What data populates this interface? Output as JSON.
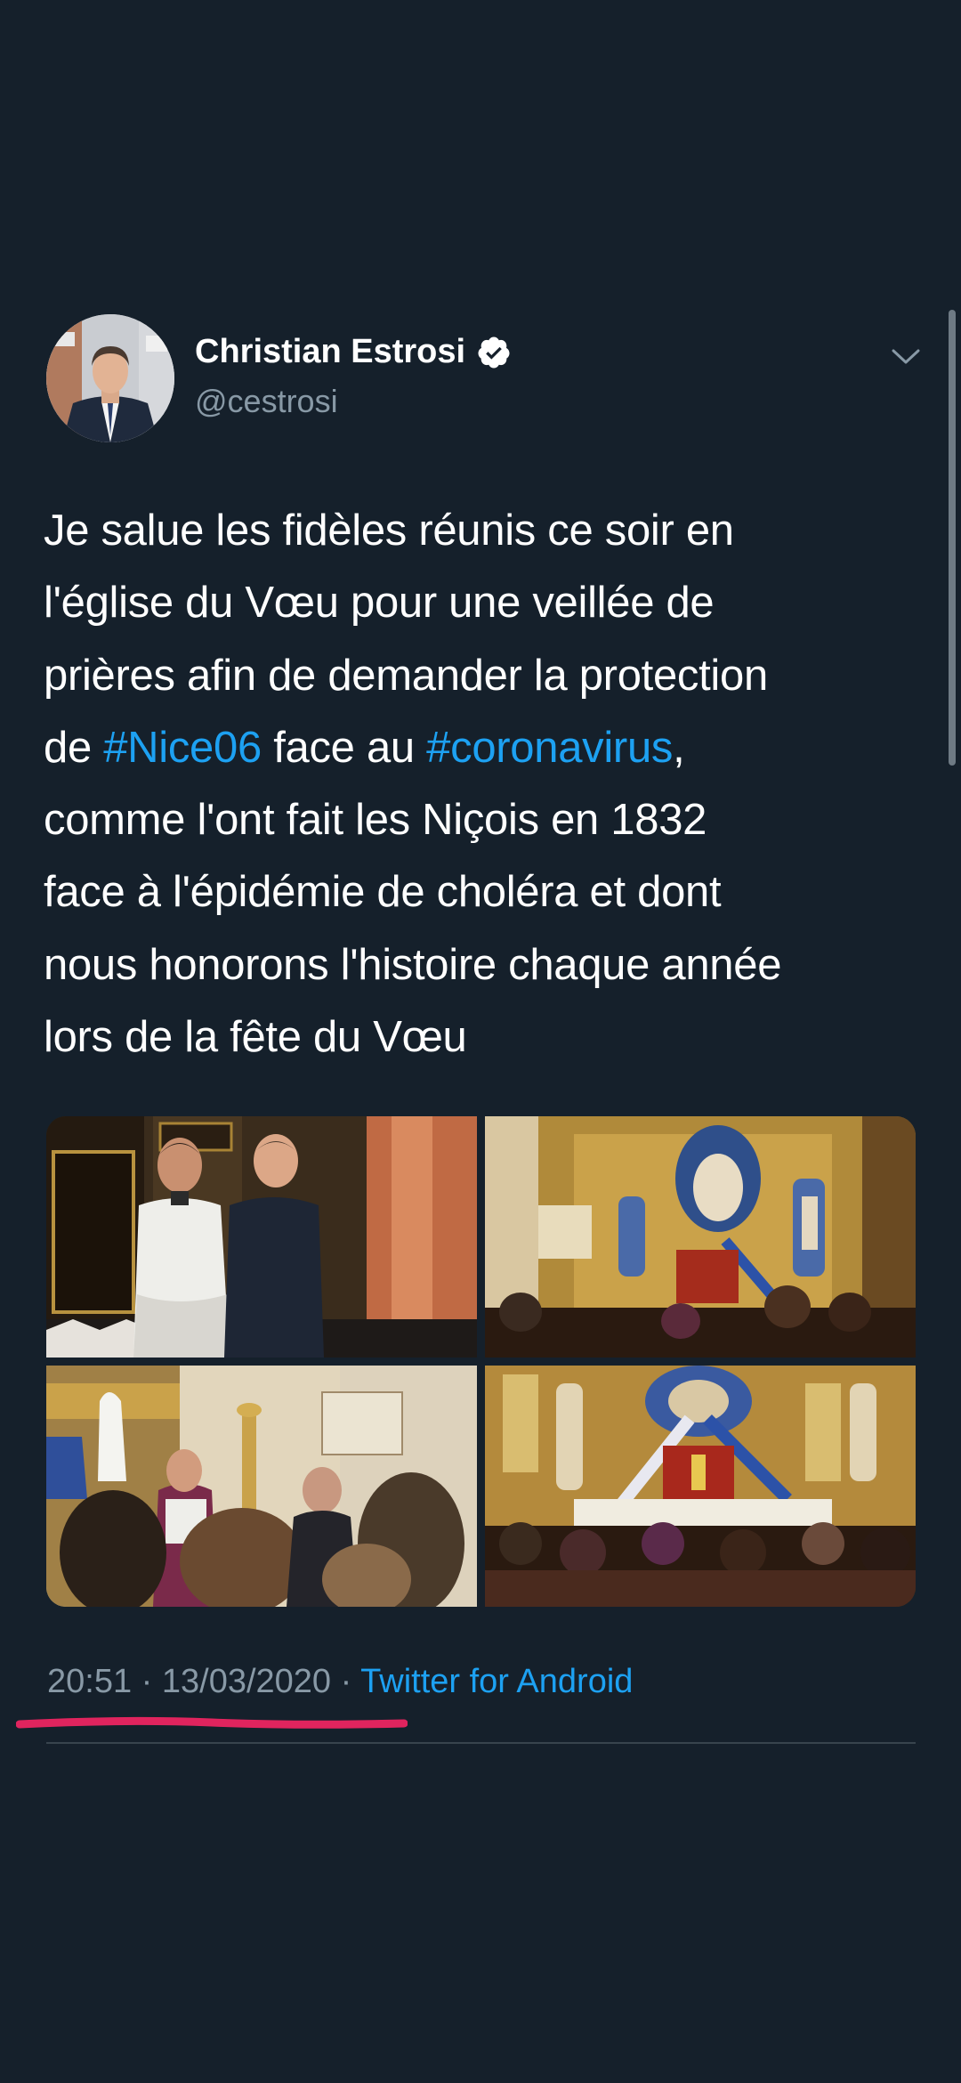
{
  "author": {
    "name": "Christian Estrosi",
    "handle": "@cestrosi",
    "verified": true
  },
  "tweet": {
    "lines": [
      [
        {
          "text": "Je salue les fidèles réunis ce soir en"
        }
      ],
      [
        {
          "text": "l'église du Vœu pour une veillée de"
        }
      ],
      [
        {
          "text": "prières afin de demander la protection"
        }
      ],
      [
        {
          "text": "de "
        },
        {
          "text": "#Nice06",
          "hashtag": true
        },
        {
          "text": " face au "
        },
        {
          "text": "#coronavirus",
          "hashtag": true
        },
        {
          "text": ","
        }
      ],
      [
        {
          "text": "comme l'ont fait les Niçois en 1832"
        }
      ],
      [
        {
          "text": "face à l'épidémie de choléra et dont"
        }
      ],
      [
        {
          "text": "nous honorons l'histoire chaque année"
        }
      ],
      [
        {
          "text": "lors de la fête du Vœu"
        }
      ]
    ],
    "photos": [
      {
        "name": "photo-priest-and-mayor"
      },
      {
        "name": "photo-church-altar"
      },
      {
        "name": "photo-priest-speaking"
      },
      {
        "name": "photo-congregation-altar"
      }
    ]
  },
  "meta": {
    "time": "20:51",
    "separator": " · ",
    "date": "13/03/2020",
    "source": "Twitter for Android"
  },
  "colors": {
    "background": "#15202b",
    "text": "#ffffff",
    "secondary": "#8899a6",
    "link": "#1da1f2",
    "divider": "#38444d",
    "annotation": "#e0245e"
  },
  "icons": {
    "verified": "verified-badge-icon",
    "chevron": "chevron-down-icon"
  }
}
